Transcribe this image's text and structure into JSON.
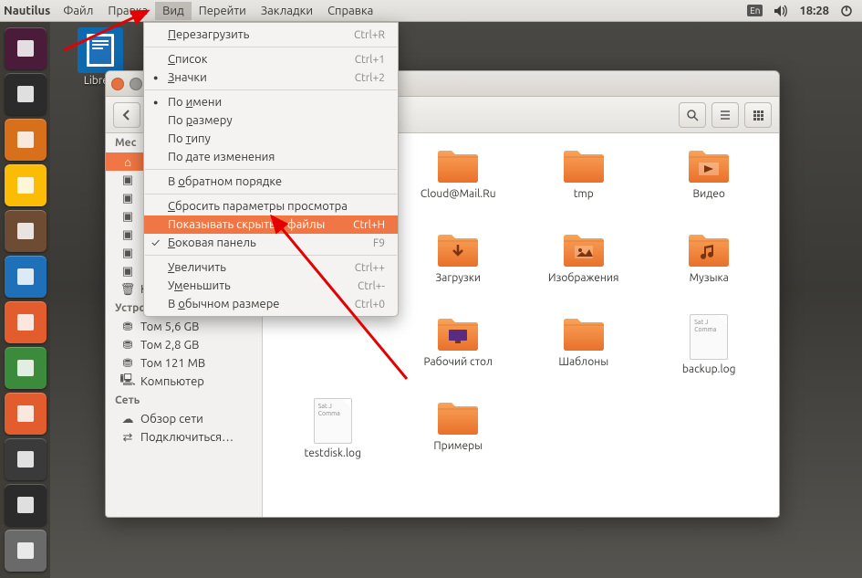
{
  "panel": {
    "app": "Nautilus",
    "menus": [
      "Файл",
      "Правка",
      "Вид",
      "Перейти",
      "Закладки",
      "Справка"
    ],
    "lang": "En",
    "time": "18:28"
  },
  "desktop_icon": {
    "label": "LibreO"
  },
  "dropdown": {
    "items": [
      {
        "label": "Перезагрузить",
        "shortcut": "Ctrl+R",
        "u": 0
      },
      {
        "sep": true
      },
      {
        "label": "Список",
        "shortcut": "Ctrl+1",
        "u": 0
      },
      {
        "label": "Значки",
        "shortcut": "Ctrl+2",
        "u": 0,
        "bullet": true
      },
      {
        "sep": true
      },
      {
        "label": "По имени",
        "u": 3,
        "bullet": true
      },
      {
        "label": "По размеру",
        "u": 3
      },
      {
        "label": "По типу",
        "u": 3
      },
      {
        "label": "По дате изменения"
      },
      {
        "sep": true
      },
      {
        "label": "В обратном порядке",
        "u": 2
      },
      {
        "sep": true
      },
      {
        "label": "Сбросить параметры просмотра",
        "u": 0
      },
      {
        "label": "Показывать скрытые файлы",
        "shortcut": "Ctrl+H",
        "hl": true
      },
      {
        "label": "Боковая панель",
        "shortcut": "F9",
        "u": 0,
        "check": true
      },
      {
        "sep": true
      },
      {
        "label": "Увеличить",
        "shortcut": "Ctrl++",
        "u": 0
      },
      {
        "label": "Уменьшить",
        "shortcut": "Ctrl+-",
        "u": 1
      },
      {
        "label": "В обычном размере",
        "shortcut": "Ctrl+0",
        "u": 2
      }
    ]
  },
  "sidebar": {
    "sections": [
      {
        "title": "Мес",
        "items": [
          {
            "label": "",
            "active": true,
            "icon": "home"
          },
          {
            "label": "",
            "icon": "folder"
          },
          {
            "label": "",
            "icon": "folder"
          },
          {
            "label": "",
            "icon": "folder"
          },
          {
            "label": "",
            "icon": "folder"
          },
          {
            "label": "",
            "icon": "folder"
          },
          {
            "label": "",
            "icon": "folder"
          },
          {
            "label": "Корзина",
            "icon": "trash"
          }
        ]
      },
      {
        "title": "Устройства",
        "items": [
          {
            "label": "Том 5,6 GB",
            "icon": "disk"
          },
          {
            "label": "Том 2,8 GB",
            "icon": "disk"
          },
          {
            "label": "Том 121 MB",
            "icon": "disk"
          },
          {
            "label": "Компьютер",
            "icon": "computer"
          }
        ]
      },
      {
        "title": "Сеть",
        "items": [
          {
            "label": "Обзор сети",
            "icon": "net"
          },
          {
            "label": "Подключиться…",
            "icon": "connect"
          }
        ]
      }
    ]
  },
  "files": [
    {
      "name": "Cloud@Mail.Ru",
      "type": "folder"
    },
    {
      "name": "tmp",
      "type": "folder"
    },
    {
      "name": "Видео",
      "type": "folder",
      "variant": "video"
    },
    {
      "name": "Загрузки",
      "type": "folder",
      "variant": "download"
    },
    {
      "name": "Изображения",
      "type": "folder",
      "variant": "pictures"
    },
    {
      "name": "Музыка",
      "type": "folder",
      "variant": "music"
    },
    {
      "name": "Рабочий стол",
      "type": "folder",
      "variant": "desktop"
    },
    {
      "name": "Шаблоны",
      "type": "folder"
    },
    {
      "name": "backup.log",
      "type": "file"
    },
    {
      "name": "testdisk.log",
      "type": "file"
    },
    {
      "name": "Примеры",
      "type": "folder"
    }
  ],
  "launcher_colors": [
    "#4a1c3a",
    "#2b2b2b",
    "#d86f1b",
    "#fbbc05",
    "#6e4b33",
    "#1e70b8",
    "#e35c2d",
    "#3c8a3c",
    "#e35c2d",
    "#3a3a3a",
    "#2b2b2b",
    "#6a6a6a"
  ]
}
